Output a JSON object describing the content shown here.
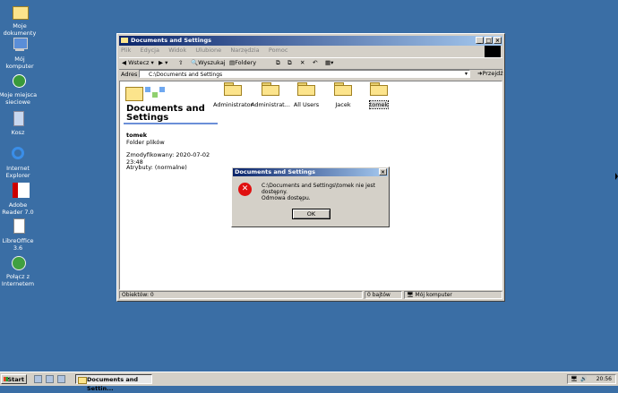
{
  "desktop": {
    "icons": [
      {
        "label": "Moje dokumenty"
      },
      {
        "label": "Mój komputer"
      },
      {
        "label": "Moje miejsca sieciowe"
      },
      {
        "label": "Kosz"
      },
      {
        "label": "Internet Explorer"
      },
      {
        "label": "Adobe Reader 7.0"
      },
      {
        "label": "LibreOffice 3.6"
      },
      {
        "label": "Połącz z Internetem"
      }
    ]
  },
  "window": {
    "title": "Documents and Settings",
    "menu": [
      "Plik",
      "Edycja",
      "Widok",
      "Ulubione",
      "Narzędzia",
      "Pomoc"
    ],
    "toolbar": {
      "back": "Wstecz",
      "search": "Wyszukaj",
      "folders": "Foldery"
    },
    "address_label": "Adres",
    "address_value": "C:\\Documents and Settings",
    "go_label": "Przejdź",
    "left_pane": {
      "folder_title": "Documents and Settings",
      "selected_name": "tomek",
      "selected_type": "Folder plików",
      "modified": "Zmodyfikowany: 2020-07-02 23:48",
      "attributes": "Atrybuty: (normalne)"
    },
    "items": [
      "Administrator",
      "Administrat...",
      "All Users",
      "Jacek",
      "tomek"
    ],
    "status": {
      "objects": "Obiektów: 0",
      "size": "0 bajtów",
      "location": "Mój komputer"
    }
  },
  "dialog": {
    "title": "Documents and Settings",
    "message": "C:\\Documents and Settings\\tomek nie jest dostępny.",
    "detail": "Odmowa dostępu.",
    "ok": "OK"
  },
  "taskbar": {
    "start": "Start",
    "task": "Documents and Settin...",
    "clock": "20:56"
  }
}
